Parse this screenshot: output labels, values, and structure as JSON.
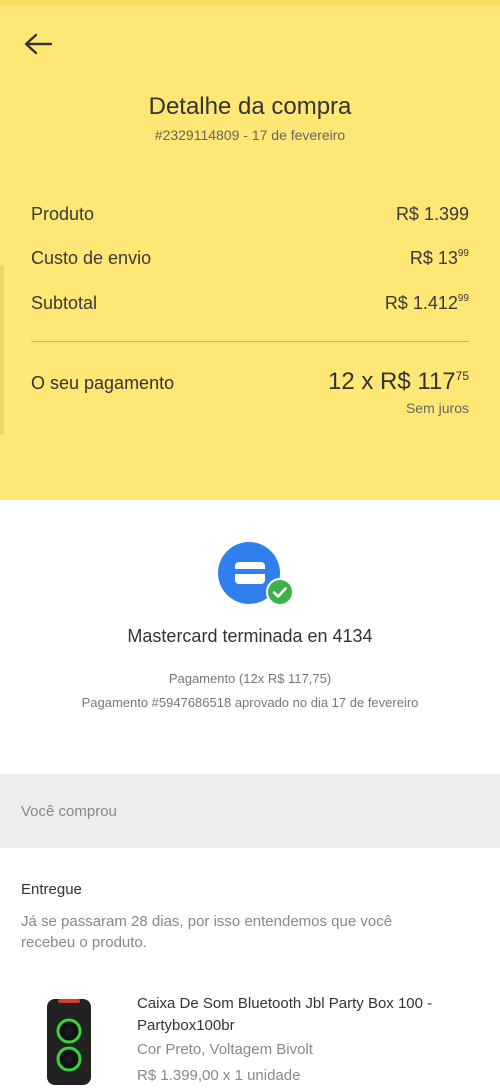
{
  "header": {
    "title": "Detalhe da compra",
    "subtitle": "#2329114809 - 17 de fevereiro"
  },
  "summary": {
    "produto_label": "Produto",
    "produto_value": "R$ 1.399",
    "envio_label": "Custo de envio",
    "envio_value": "R$ 13",
    "envio_cents": "99",
    "subtotal_label": "Subtotal",
    "subtotal_value": "R$ 1.412",
    "subtotal_cents": "99",
    "payment_label": "O seu pagamento",
    "payment_value": "12 x R$ 117",
    "payment_cents": "75",
    "payment_note": "Sem juros"
  },
  "payment": {
    "card_text": "Mastercard terminada en 4134",
    "line1": "Pagamento (12x R$ 117,75)",
    "line2": "Pagamento #5947686518 aprovado no dia 17 de fevereiro"
  },
  "purchase": {
    "section_label": "Você comprou",
    "status": "Entregue",
    "status_message": "Já se passaram 28 dias, por isso entendemos que você recebeu o produto.",
    "product_title": "Caixa De Som Bluetooth Jbl Party Box 100 - Partybox100br",
    "product_variant": "Cor Preto, Voltagem Bivolt",
    "product_price": "R$ 1.399,00 x 1 unidade"
  },
  "colors": {
    "header_bg": "#fee774",
    "accent_blue": "#2f80ee",
    "check_green": "#3ab24a"
  },
  "icons": {
    "back": "arrow-left-icon",
    "card": "credit-card-icon",
    "check": "check-icon"
  }
}
